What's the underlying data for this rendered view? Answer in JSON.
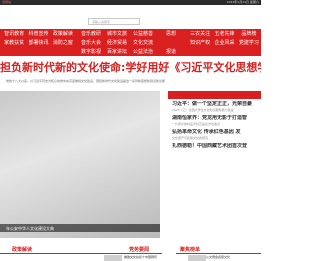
{
  "topbar": {
    "left": "旧网站",
    "right": "2023年1月14日 星期六"
  },
  "search": {
    "placeholder": "请输入关键字"
  },
  "nav": {
    "group1": [
      "智讯教育",
      "科普宣传",
      "政策解读",
      "家教扶贫",
      "部署快讯",
      "消防之窗",
      "",
      "",
      ""
    ],
    "group2": [
      "音乐教研",
      "城市文旅",
      "公益慈善",
      "音乐大会",
      "经济贸易",
      "文化交流",
      "数字影视",
      "百家讲坛",
      "公益法治"
    ],
    "group3": [
      "思想",
      "",
      "报道"
    ],
    "group4": [
      "三农关注",
      "五老先锋",
      "品牌榜",
      "知识产权",
      "企业风采",
      "党建学习",
      "",
      "",
      ""
    ]
  },
  "headline": "担负新时代新的文化使命:学好用好《习近平文化思想学习纲要",
  "summary": "党的十八大以来，以习近平同志为核心的党中央高度重视文化建设，围绕新时代文化建设提出一系列新思想新观点新论断",
  "hero_caption": "年公安中华人文化建设大典",
  "panel": {
    "title": "智讯教育",
    "items": [
      {
        "lead": "习近平：做一个坚定正正，光荣自豪",
        "sub": "2023（乙）全国大学生文化知识服务能力建设"
      },
      {
        "lead": "湖南恒家界：党龙用无影于打造智",
        "sub": "一片家乡的村庄农村正是全方位改善"
      },
      {
        "lead": "弘扬革命文化 传承红色基因 发",
        "sub": "文化遗产与民族文化的研究"
      },
      {
        "lead": "扎西德勒！中国西藏艺术团首次登",
        "sub": ""
      }
    ]
  },
  "sections": {
    "left": "政策解读",
    "middle": "党务要闻",
    "right": "聚焦榜单"
  },
  "bottom": {
    "middle_text": "推致文化扶贫十中国网传",
    "right_text": "从文博会感受文化"
  }
}
